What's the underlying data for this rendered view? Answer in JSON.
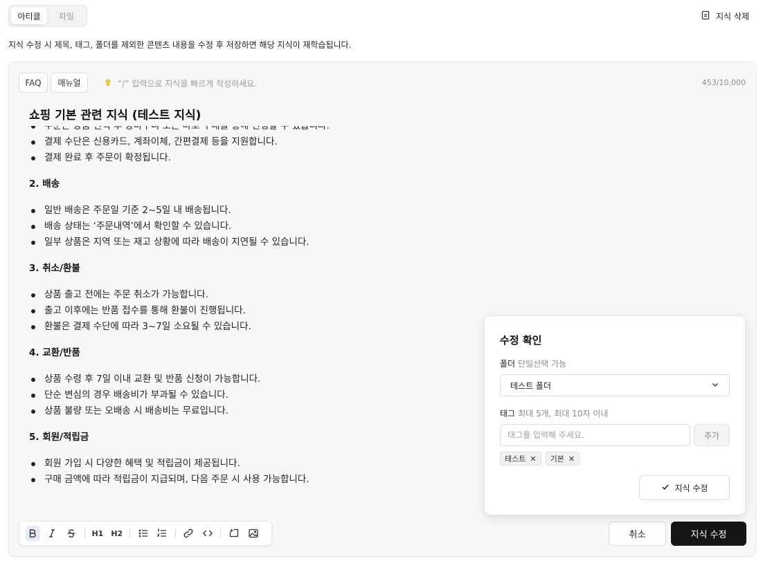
{
  "tabs": [
    {
      "label": "아티클",
      "active": true
    },
    {
      "label": "파일",
      "active": false
    }
  ],
  "delete_label": "지식 삭제",
  "notice": "지식 수정 시 제목, 태그, 폴더를 제외한 콘텐츠 내용을 수정 후 저장하면 해당 지식이 재학습됩니다.",
  "editor": {
    "buttons": {
      "faq": "FAQ",
      "manual": "매뉴얼"
    },
    "hint": "“/” 입력으로 지식을 빠르게 작성하세요.",
    "counter": "453/10,000",
    "title": "쇼핑 기본 관련 지식 (테스트 지식)",
    "lines": [
      {
        "type": "bullet",
        "text": "주문은 상품 선택 후 장바구니 또는 바로 구매를 통해 진행할 수 있습니다."
      },
      {
        "type": "bullet",
        "text": "결제 수단은 신용카드, 계좌이체, 간편결제 등을 지원합니다."
      },
      {
        "type": "bullet",
        "text": "결제 완료 후 주문이 확정됩니다."
      },
      {
        "type": "heading",
        "text": "2. 배송"
      },
      {
        "type": "bullet",
        "text": "일반 배송은 주문일 기준 2~5일 내 배송됩니다."
      },
      {
        "type": "bullet",
        "text": "배송 상태는 ‘주문내역’에서 확인할 수 있습니다."
      },
      {
        "type": "bullet",
        "text": "일부 상품은 지역 또는 재고 상황에 따라 배송이 지연될 수 있습니다."
      },
      {
        "type": "heading",
        "text": "3. 취소/환불"
      },
      {
        "type": "bullet",
        "text": "상품 출고 전에는 주문 취소가 가능합니다."
      },
      {
        "type": "bullet",
        "text": "출고 이후에는 반품 접수를 통해 환불이 진행됩니다."
      },
      {
        "type": "bullet",
        "text": "환불은 결제 수단에 따라 3~7일 소요될 수 있습니다."
      },
      {
        "type": "heading",
        "text": "4. 교환/반품"
      },
      {
        "type": "bullet",
        "text": "상품 수령 후 7일 이내 교환 및 반품 신청이 가능합니다."
      },
      {
        "type": "bullet",
        "text": "단순 변심의 경우 배송비가 부과될 수 있습니다."
      },
      {
        "type": "bullet",
        "text": "상품 불량 또는 오배송 시 배송비는 무료입니다."
      },
      {
        "type": "heading",
        "text": "5. 회원/적립금"
      },
      {
        "type": "bullet",
        "text": "회원 가입 시 다양한 혜택 및 적립금이 제공됩니다."
      },
      {
        "type": "bullet",
        "text": "구매 금액에 따라 적립금이 지급되며, 다음 주문 시 사용 가능합니다."
      }
    ],
    "toolbar": {
      "h1": "H1",
      "h2": "H2"
    }
  },
  "footer": {
    "cancel": "취소",
    "save": "지식 수정"
  },
  "modal": {
    "title": "수정 확인",
    "folder_label": "폴더",
    "folder_sub": "단일선택 가능",
    "folder_value": "테스트 폴더",
    "tag_label": "태그",
    "tag_sub": "최대 5개, 최대 10자 이내",
    "tag_placeholder": "태그를 입력해 주세요.",
    "add_label": "추가",
    "tags": [
      "테스트",
      "기본"
    ],
    "confirm_label": "지식 수정"
  }
}
